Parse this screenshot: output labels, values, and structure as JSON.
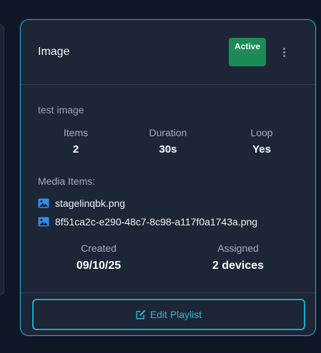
{
  "card": {
    "title": "Image",
    "status": "Active",
    "description": "test image",
    "stats": {
      "items_label": "Items",
      "items_value": "2",
      "duration_label": "Duration",
      "duration_value": "30s",
      "loop_label": "Loop",
      "loop_value": "Yes"
    },
    "media_heading": "Media Items:",
    "media_items": [
      {
        "name": "stagelinqbk.png",
        "icon": "image-icon"
      },
      {
        "name": "8f51ca2c-e290-48c7-8c98-a117f0a1743a.png",
        "icon": "image-icon"
      }
    ],
    "meta": {
      "created_label": "Created",
      "created_value": "09/10/25",
      "assigned_label": "Assigned",
      "assigned_value": "2 devices"
    },
    "edit_button_label": "Edit Playlist"
  },
  "colors": {
    "background": "#0f1726",
    "card": "#1d2636",
    "accent": "#1aa9c9",
    "status_green": "#1b8a57"
  }
}
